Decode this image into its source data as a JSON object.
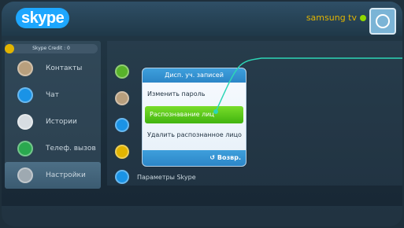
{
  "app": {
    "logo_text": "skype"
  },
  "header": {
    "user": "samsung tv"
  },
  "credit": {
    "label": "Skype Credit : 0"
  },
  "nav": {
    "items": [
      {
        "label": "Контакты",
        "icon": "contacts-icon"
      },
      {
        "label": "Чат",
        "icon": "chat-icon"
      },
      {
        "label": "Истории",
        "icon": "history-icon"
      },
      {
        "label": "Телеф. вызов",
        "icon": "call-icon"
      },
      {
        "label": "Настройки",
        "icon": "settings-icon"
      }
    ]
  },
  "settings": {
    "rows": [
      {
        "label": "",
        "icon": "check-icon"
      },
      {
        "label": "",
        "icon": "person-icon"
      },
      {
        "label": "",
        "icon": "face-recognition-icon"
      },
      {
        "label": "",
        "icon": "face-icon"
      },
      {
        "label": "Параметры Skype",
        "icon": "skype-icon"
      }
    ]
  },
  "dialog": {
    "title": "Дисп. уч. записей",
    "items": [
      "Изменить пароль",
      "Распознавание лиц",
      "Удалить распознанное лицо"
    ],
    "back": "Возвр."
  },
  "colors": {
    "accent_blue": "#2c86c7",
    "highlight_green": "#41b40f",
    "user_name": "#e2b400"
  }
}
